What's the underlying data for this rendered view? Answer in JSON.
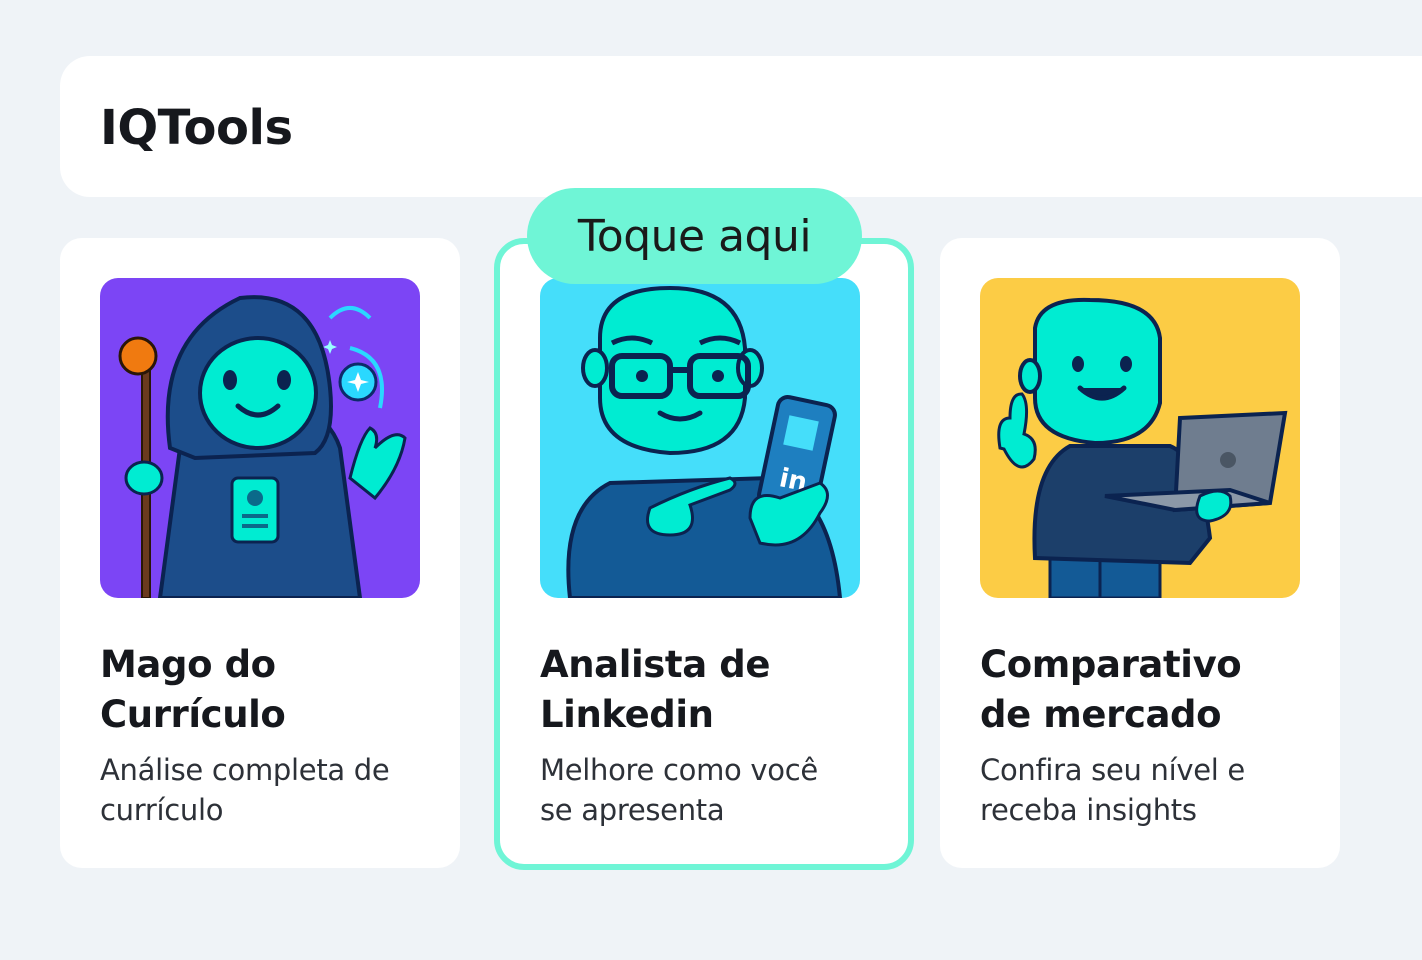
{
  "header": {
    "title": "IQTools"
  },
  "tooltip": {
    "label": "Toque aqui"
  },
  "cards": [
    {
      "title_line1": "Mago do",
      "title_line2": "Currículo",
      "desc_line1": "Análise completa de",
      "desc_line2": "currículo",
      "image_bg": "#7c45f5",
      "image_icon": "wizard-illustration"
    },
    {
      "title_line1": "Analista de",
      "title_line2": "Linkedin",
      "desc_line1": "Melhore como você",
      "desc_line2": "se apresenta",
      "image_bg": "#45defa",
      "image_icon": "linkedin-analyst-illustration"
    },
    {
      "title_line1": "Comparativo",
      "title_line2": "de mercado",
      "desc_line1": "Confira seu nível e",
      "desc_line2": "receba insights",
      "image_bg": "#fccc45",
      "image_icon": "laptop-person-illustration"
    }
  ],
  "colors": {
    "accent": "#6ff5d6",
    "character": "#00ecd2",
    "background": "#eff3f7"
  }
}
